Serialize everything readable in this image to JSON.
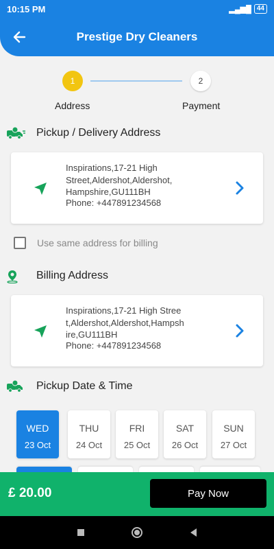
{
  "status_bar": {
    "time": "10:15 PM",
    "battery": "44"
  },
  "header": {
    "title": "Prestige Dry Cleaners",
    "back_icon": "arrow-left-icon"
  },
  "stepper": {
    "steps": [
      {
        "number": "1",
        "label": "Address",
        "active": true
      },
      {
        "number": "2",
        "label": "Payment",
        "active": false
      }
    ]
  },
  "pickup": {
    "title": "Pickup / Delivery Address",
    "address": "Inspirations,17-21 High Street,Aldershot,Aldershot, Hampshire,GU111BH",
    "phone": "Phone: +447891234568"
  },
  "billing_checkbox": {
    "label": "Use same address for billing",
    "checked": false
  },
  "billing": {
    "title": "Billing Address",
    "address": "Inspirations,17-21 High Street,Aldershot,Aldershot,Hampshire,GU111BH",
    "phone": "Phone: +447891234568"
  },
  "pickup_datetime": {
    "title": "Pickup Date & Time",
    "dates": [
      {
        "day": "WED",
        "date": "23 Oct",
        "selected": true
      },
      {
        "day": "THU",
        "date": "24 Oct",
        "selected": false
      },
      {
        "day": "FRI",
        "date": "25 Oct",
        "selected": false
      },
      {
        "day": "SAT",
        "date": "26 Oct",
        "selected": false
      },
      {
        "day": "SUN",
        "date": "27 Oct",
        "selected": false
      }
    ]
  },
  "footer": {
    "price": "£ 20.00",
    "pay_label": "Pay Now"
  },
  "colors": {
    "primary": "#1a82e2",
    "accent_green": "#10b26b",
    "step_active": "#f2c511",
    "icon_green": "#17a35a"
  }
}
